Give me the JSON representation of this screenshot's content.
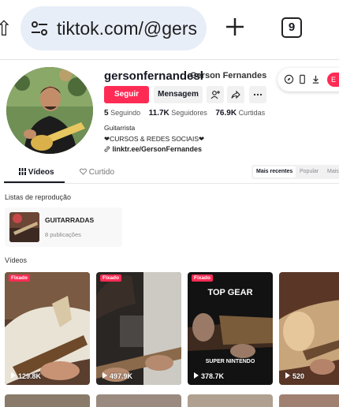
{
  "browser": {
    "url": "tiktok.com/@gers",
    "tab_count": "9"
  },
  "profile": {
    "username": "gersonfernandesl",
    "nickname": "Gerson Fernandes",
    "follow_label": "Seguir",
    "message_label": "Mensagem",
    "stats": {
      "following_count": "5",
      "following_label": "Seguindo",
      "followers_count": "11.7K",
      "followers_label": "Seguidores",
      "likes_count": "76.9K",
      "likes_label": "Curtidas"
    },
    "bio_lines": [
      "Guitarrista",
      "❤CURSOS & REDES SOCIAIS❤"
    ],
    "link": "linktr.ee/GersonFernandes"
  },
  "floating_bar": {
    "action_label": "E"
  },
  "tabs": {
    "videos": "Vídeos",
    "liked": "Curtido",
    "sort": [
      "Mais recentes",
      "Popular",
      "Mais"
    ]
  },
  "playlists": {
    "title": "Listas de reprodução",
    "items": [
      {
        "name": "GUITARRADAS",
        "count": "8 publicações"
      }
    ]
  },
  "videos": {
    "title": "Vídeos",
    "items": [
      {
        "badge": "Fixado",
        "views": "129.8K"
      },
      {
        "badge": "Fixado",
        "views": "497.9K"
      },
      {
        "badge": "Fixado",
        "views": "378.7K",
        "caption_top": "TOP GEAR",
        "caption_bottom": "SUPER NINTENDO"
      },
      {
        "badge": "",
        "views": "520"
      }
    ]
  },
  "colors": {
    "accent": "#fe2c55",
    "text": "#161823"
  }
}
